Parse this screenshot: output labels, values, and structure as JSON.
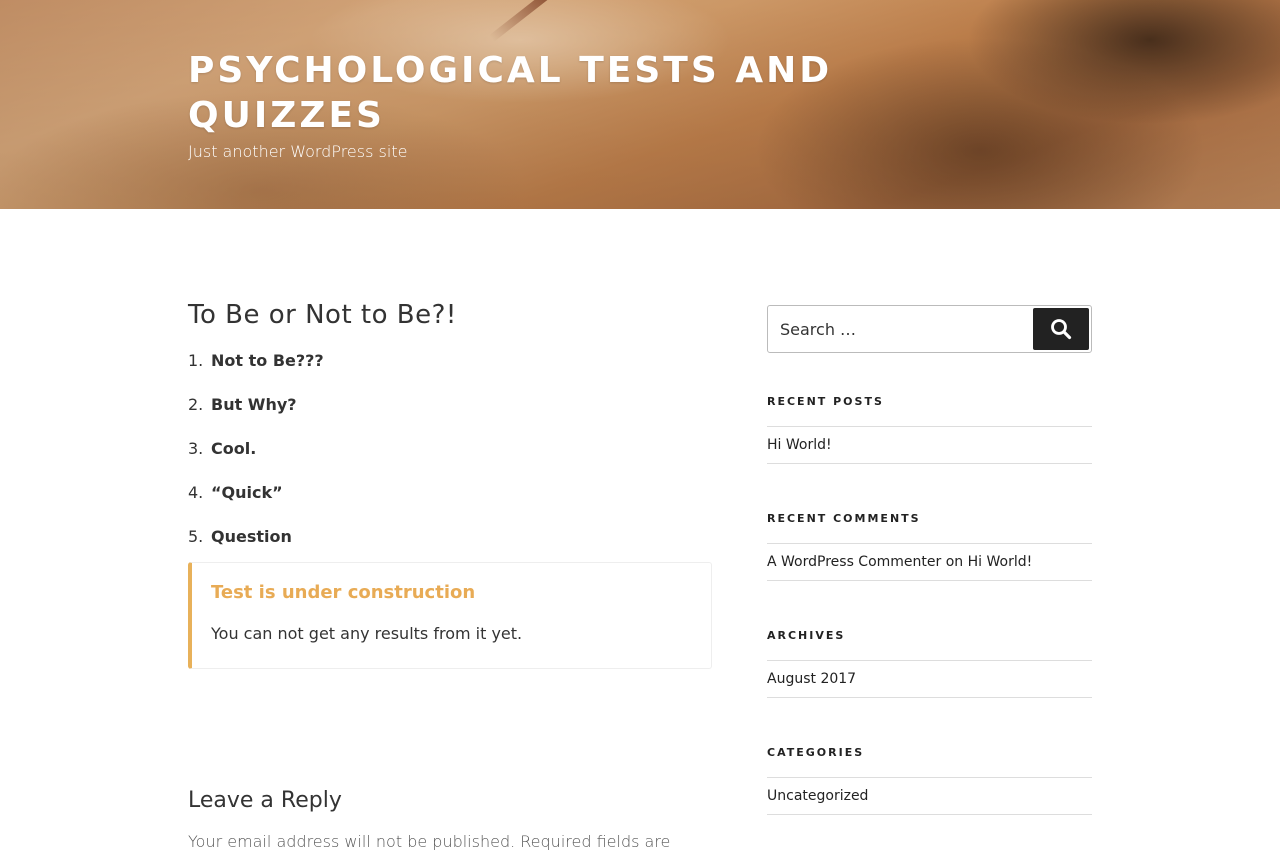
{
  "header": {
    "site_title": "PSYCHOLOGICAL TESTS AND QUIZZES",
    "site_description": "Just another WordPress site"
  },
  "post": {
    "title": "To Be or Not to Be?!",
    "answers": [
      {
        "num": "1.",
        "text": "Not to Be???"
      },
      {
        "num": "2.",
        "text": "But Why?"
      },
      {
        "num": "3.",
        "text": "Cool."
      },
      {
        "num": "4.",
        "text": "“Quick”"
      },
      {
        "num": "5.",
        "text": "Question"
      }
    ],
    "notice": {
      "title": "Test is under construction",
      "text": "You can not get any results from it yet.",
      "accent_color": "#e8b15a"
    }
  },
  "comments": {
    "reply_title": "Leave a Reply",
    "notes": "Your email address will not be published. Required fields are"
  },
  "sidebar": {
    "search": {
      "placeholder": "Search …",
      "submit_icon": "search-icon"
    },
    "recent_posts": {
      "title": "RECENT POSTS",
      "items": [
        "Hi World!"
      ]
    },
    "recent_comments": {
      "title": "RECENT COMMENTS",
      "items": [
        {
          "author": "A WordPress Commenter",
          "sep": "on",
          "post": "Hi World!"
        }
      ]
    },
    "archives": {
      "title": "ARCHIVES",
      "items": [
        "August 2017"
      ]
    },
    "categories": {
      "title": "CATEGORIES",
      "items": [
        "Uncategorized"
      ]
    }
  }
}
